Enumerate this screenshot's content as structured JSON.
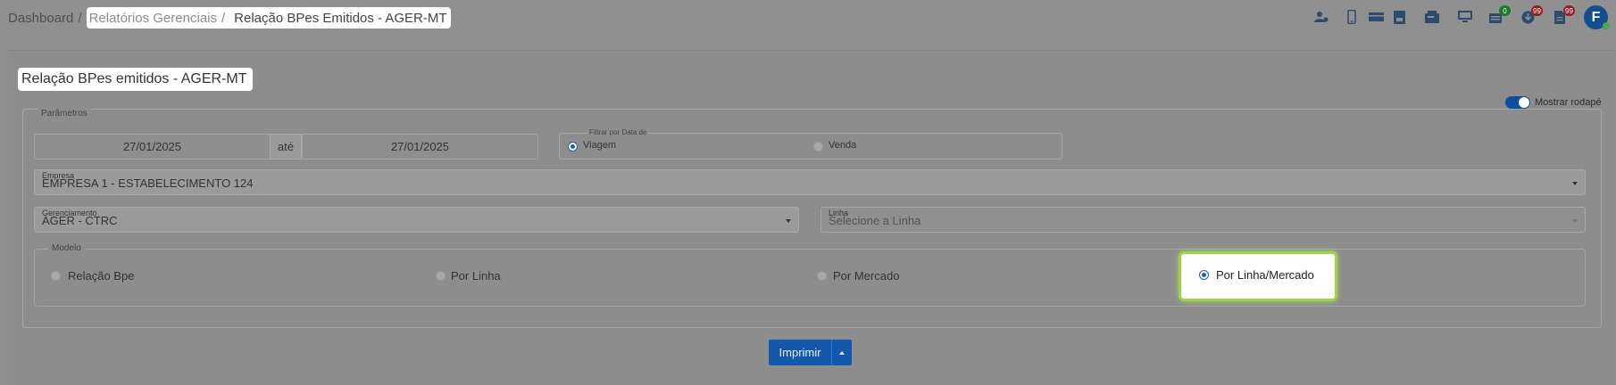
{
  "breadcrumb": {
    "home": "Dashboard",
    "section": "Relatórios Gerenciais",
    "current": "Relação BPes Emitidos - AGER-MT",
    "separator": "/"
  },
  "top_icons": [
    {
      "name": "user-settings-icon"
    },
    {
      "name": "mobile-icon"
    },
    {
      "name": "ticket-icon"
    },
    {
      "name": "book-icon"
    },
    {
      "name": "fax-icon"
    },
    {
      "name": "monitor-icon"
    },
    {
      "name": "stack-icon",
      "badge": "0"
    },
    {
      "name": "download-icon",
      "badge": "99"
    },
    {
      "name": "document-icon",
      "badge": "99"
    }
  ],
  "user": {
    "initial": "F"
  },
  "page": {
    "title": "Relação BPes emitidos - AGER-MT"
  },
  "footer_toggle": {
    "label": "Mostrar rodapé",
    "on": true
  },
  "params": {
    "legend": "Parâmetros",
    "date_from": "27/01/2025",
    "date_sep": "até",
    "date_to": "27/01/2025",
    "filter_label": "Filtrar por Data de",
    "filter_options": [
      "Viagem",
      "Venda"
    ],
    "filter_selected": "Viagem",
    "empresa_label": "Empresa",
    "empresa_value": "EMPRESA 1 - ESTABELECIMENTO 124",
    "gerenciamento_label": "Gerenciamento",
    "gerenciamento_value": "AGER - CTRC",
    "linha_label": "Linha",
    "linha_placeholder": "Selecione a Linha",
    "modelo_legend": "Modelo",
    "modelo_options": [
      "Relação Bpe",
      "Por Linha",
      "Por Mercado",
      "Por Linha/Mercado"
    ],
    "modelo_selected": "Por Linha/Mercado"
  },
  "actions": {
    "print_label": "Imprimir"
  },
  "colors": {
    "primary": "#1458ad",
    "highlight": "#9fd24a",
    "badge_green": "#1e7a2a",
    "badge_red": "#9a1d26"
  }
}
